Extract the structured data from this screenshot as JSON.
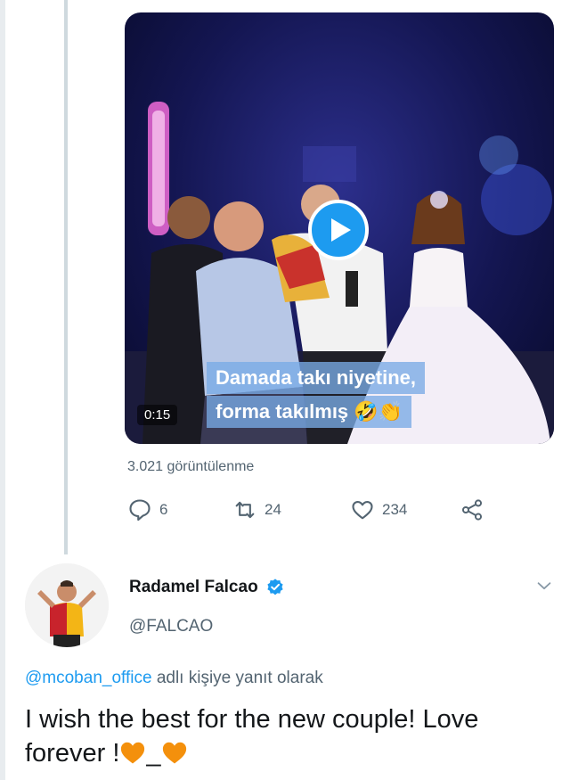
{
  "video": {
    "duration": "0:15",
    "caption_line1": "Damada takı niyetine,",
    "caption_line2": "forma takılmış",
    "caption_emoji": "🤣👏",
    "views": "3.021 görüntülenme"
  },
  "actions": {
    "reply_count": "6",
    "retweet_count": "24",
    "like_count": "234"
  },
  "author": {
    "name": "Radamel Falcao",
    "handle": "@FALCAO",
    "verified": true
  },
  "reply_to": {
    "mention": "@mcoban_office",
    "suffix": "adlı kişiye yanıt olarak"
  },
  "tweet": {
    "text_part1": "I wish the best for the new couple! Love forever !",
    "text_sep": "_"
  },
  "colors": {
    "accent": "#1d9bf0",
    "muted": "#536471",
    "heart": "#f4900c",
    "verified": "#1d9bf0"
  },
  "icons": [
    "play-icon",
    "reply-icon",
    "retweet-icon",
    "like-icon",
    "share-icon",
    "verified-badge-icon",
    "chevron-down-icon",
    "orange-heart-emoji"
  ]
}
